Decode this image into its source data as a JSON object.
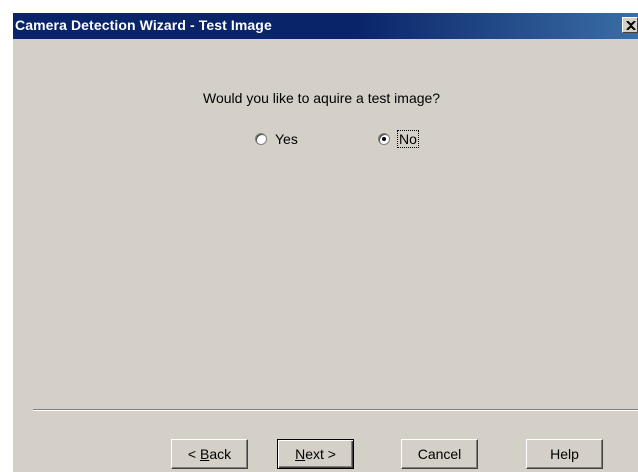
{
  "window": {
    "title": "Camera Detection Wizard - Test Image"
  },
  "prompt": {
    "question": "Would you like to aquire a test image?"
  },
  "options": [
    {
      "label": "Yes",
      "selected": false
    },
    {
      "label": "No",
      "selected": true
    }
  ],
  "buttons": {
    "back": {
      "prefix": "< ",
      "mnemonic": "B",
      "rest": "ack"
    },
    "next": {
      "mnemonic": "N",
      "rest": "ext >"
    },
    "cancel": "Cancel",
    "help": "Help"
  },
  "colors": {
    "titlebar_start": "#0a246a",
    "titlebar_end": "#3a6ea5",
    "face": "#d4d0c8"
  },
  "icons": {
    "close": "close-icon"
  }
}
